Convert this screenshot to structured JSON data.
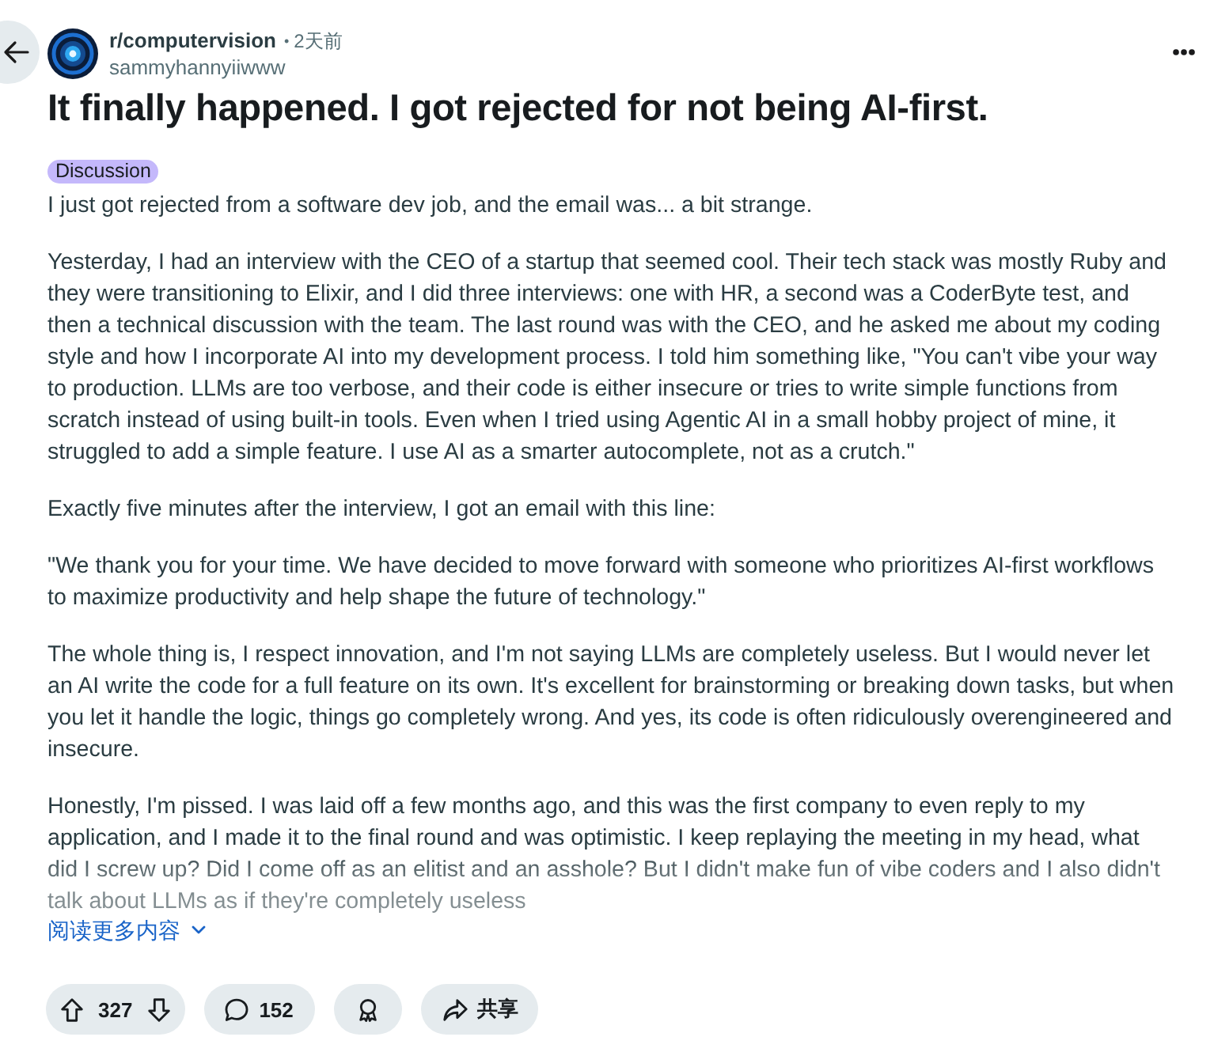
{
  "post": {
    "subreddit": "r/computervision",
    "separator": "•",
    "time": "2天前",
    "author": "sammyhannyiiwww",
    "title": "It finally happened. I got rejected for not being AI-first.",
    "flair": "Discussion",
    "collapsed": true,
    "paragraphs": [
      "I just got rejected from a software dev job, and the email was... a bit strange.",
      "Yesterday, I had an interview with the CEO of a startup that seemed cool. Their tech stack was mostly Ruby and they were transitioning to Elixir, and I did three interviews: one with HR, a second was a CoderByte test, and then a technical discussion with the team. The last round was with the CEO, and he asked me about my coding style and how I incorporate AI into my development process. I told him something like, \"You can't vibe your way to production. LLMs are too verbose, and their code is either insecure or tries to write simple functions from scratch instead of using built-in tools. Even when I tried using Agentic AI in a small hobby project of mine, it struggled to add a simple feature. I use AI as a smarter autocomplete, not as a crutch.\"",
      "Exactly five minutes after the interview, I got an email with this line:",
      "\"We thank you for your time. We have decided to move forward with someone who prioritizes AI-first workflows to maximize productivity and help shape the future of technology.\"",
      "The whole thing is, I respect innovation, and I'm not saying LLMs are completely useless. But I would never let an AI write the code for a full feature on its own. It's excellent for brainstorming or breaking down tasks, but when you let it handle the logic, things go completely wrong. And yes, its code is often ridiculously overengineered and insecure.",
      "Honestly, I'm pissed. I was laid off a few months ago, and this was the first company to even reply to my application, and I made it to the final round and was optimistic. I keep replaying the meeting in my head, what did I screw up? Did I come off as an elitist and an asshole? But I didn't make fun of vibe coders and I also didn't talk about LLMs as if they're completely useless"
    ],
    "read_more": "阅读更多内容"
  },
  "actions": [
    {
      "kind": "vote",
      "count": "327"
    },
    {
      "kind": "comments",
      "count": "152"
    },
    {
      "kind": "award"
    },
    {
      "kind": "share",
      "label": "共享"
    }
  ]
}
